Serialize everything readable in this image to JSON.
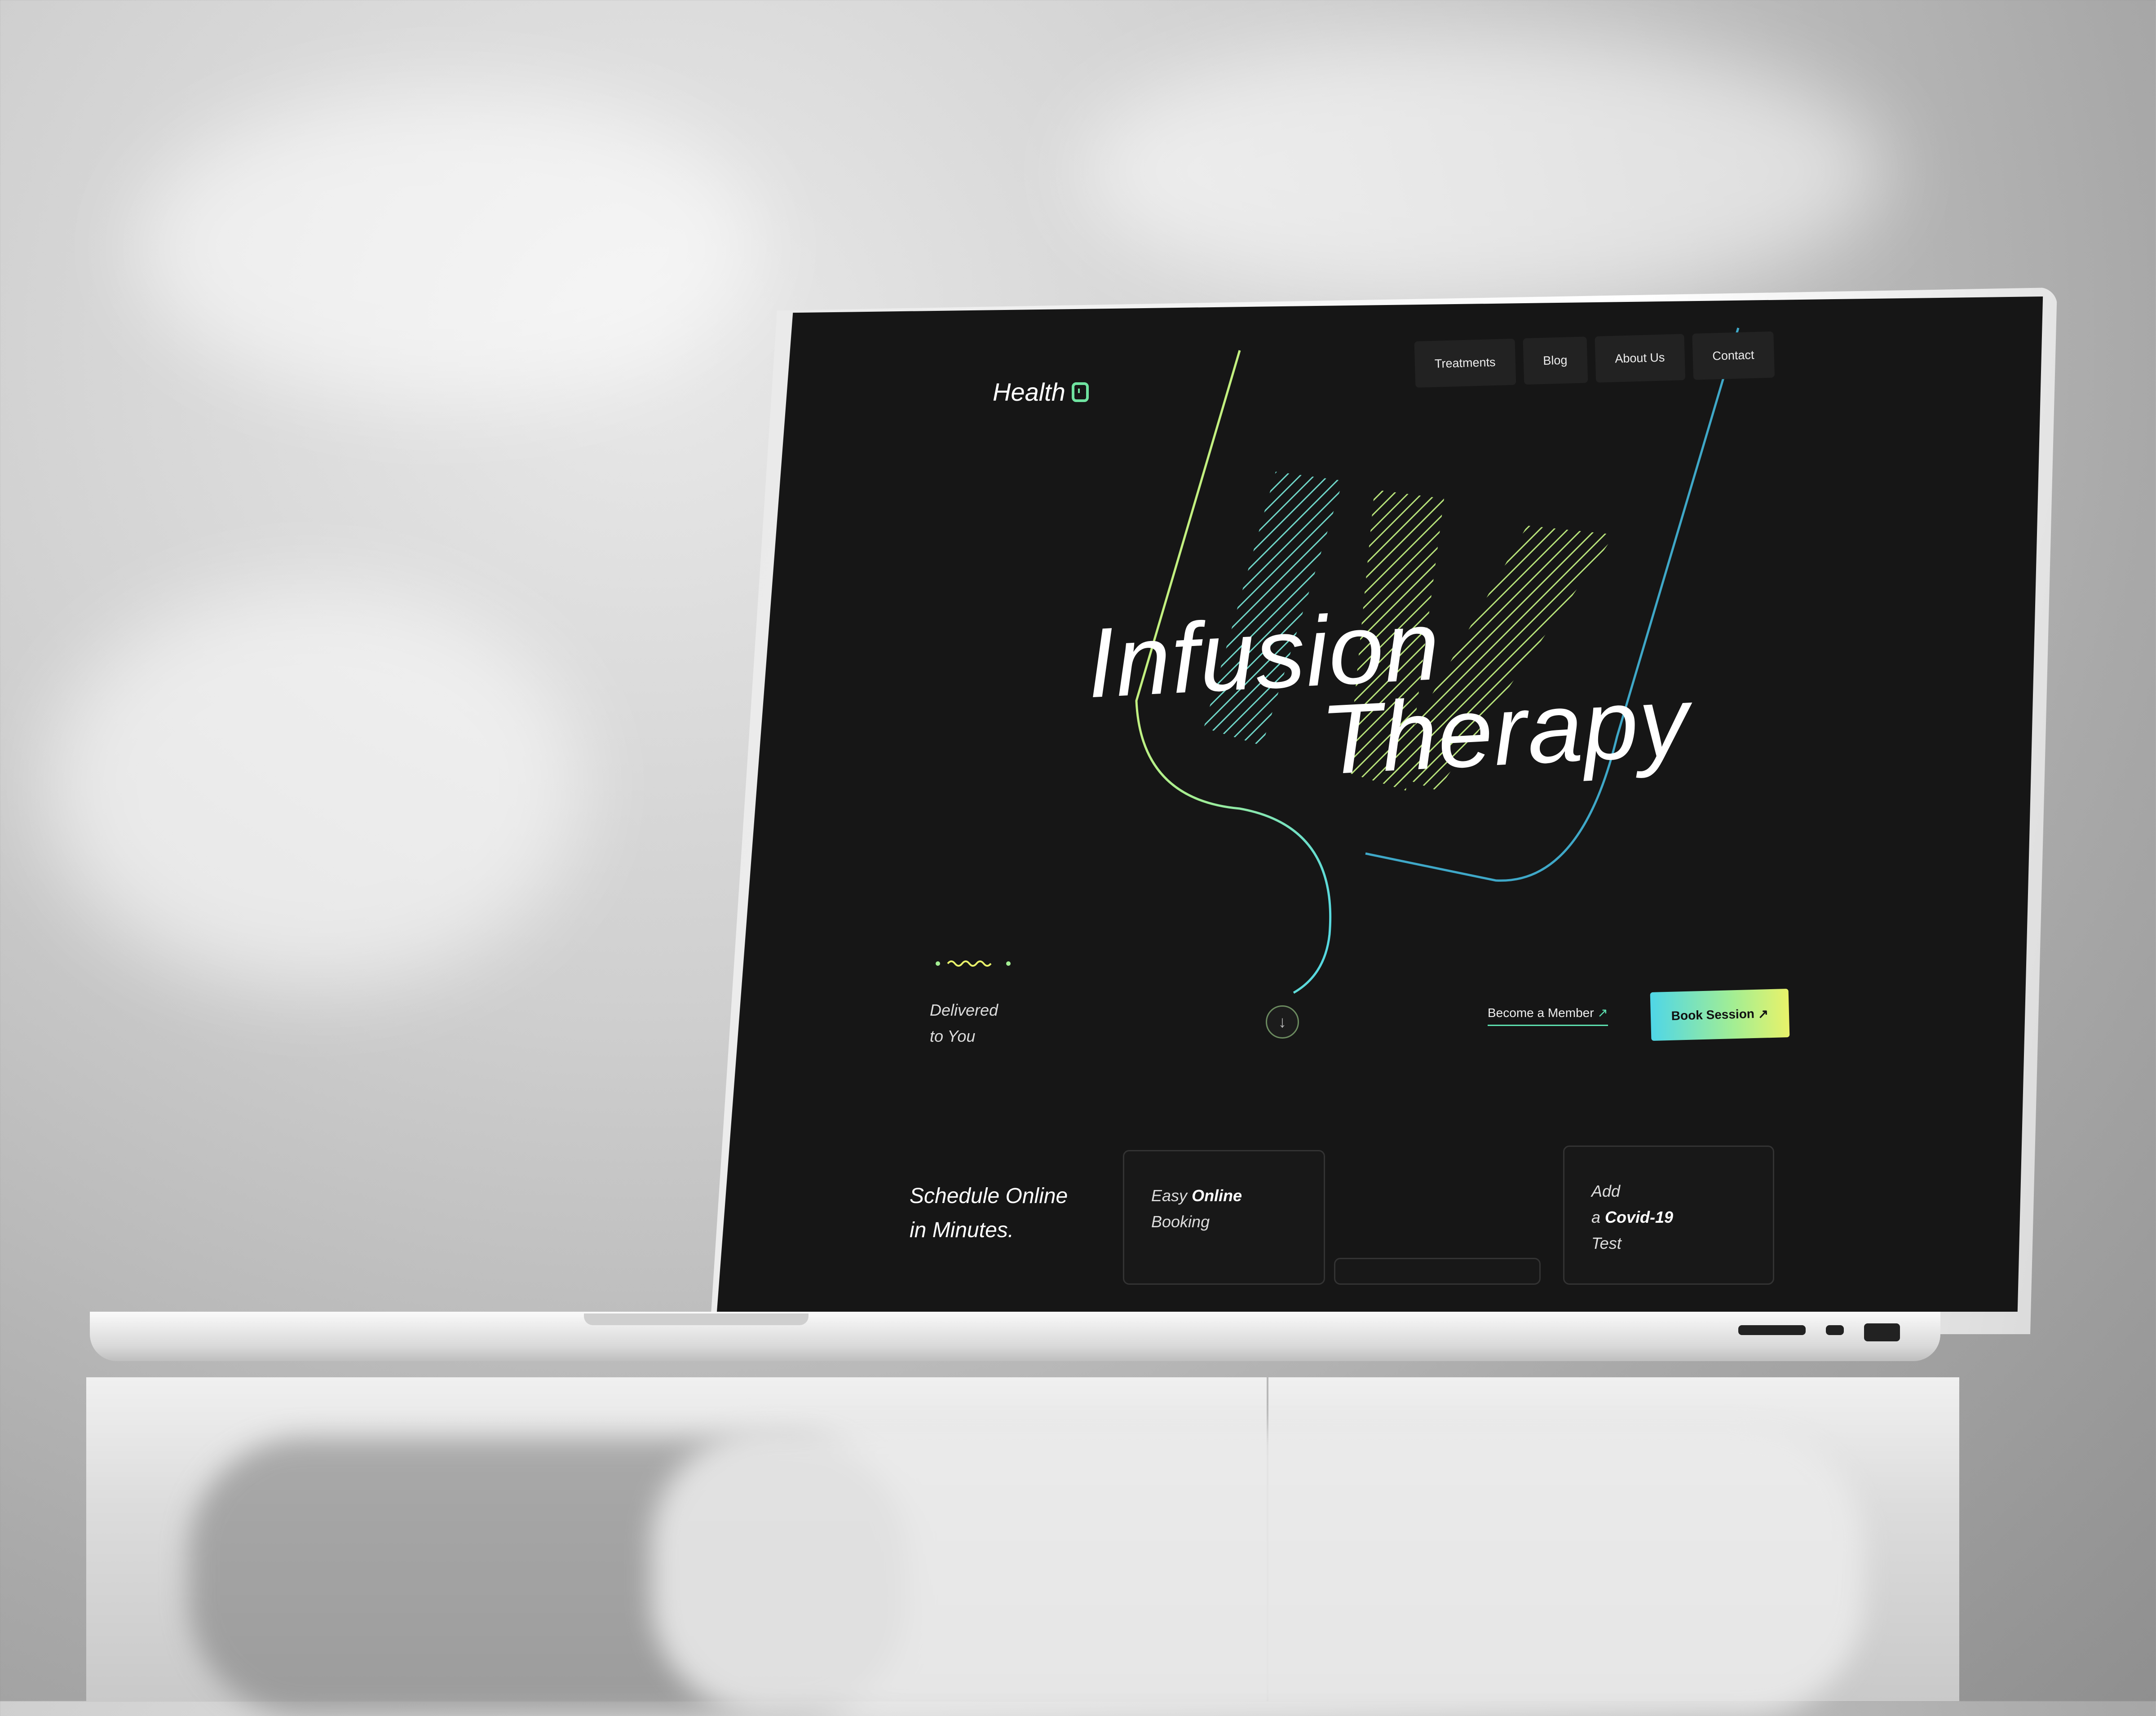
{
  "site": {
    "logo_text": "Health",
    "nav": [
      "Treatments",
      "Blog",
      "About Us",
      "Contact"
    ],
    "hero": {
      "title_line1": "Infusion",
      "title_line2": "Therapy",
      "tagline_line1": "Delivered",
      "tagline_line2": "to You"
    },
    "cta": {
      "member_label": "Become a Member",
      "book_label": "Book Session"
    },
    "section": {
      "schedule_line1": "Schedule Online",
      "schedule_line2": "in Minutes.",
      "card1_pre": "Easy",
      "card1_bold": "Online",
      "card1_post": "Booking",
      "card2_pre": "Add",
      "card2_a": "a",
      "card2_bold": "Covid-19",
      "card2_post": "Test"
    }
  },
  "colors": {
    "screen_bg": "#161616",
    "accent_green": "#6fe3a0",
    "accent_cyan": "#4fd6e7",
    "accent_yellow": "#e8f26a"
  }
}
